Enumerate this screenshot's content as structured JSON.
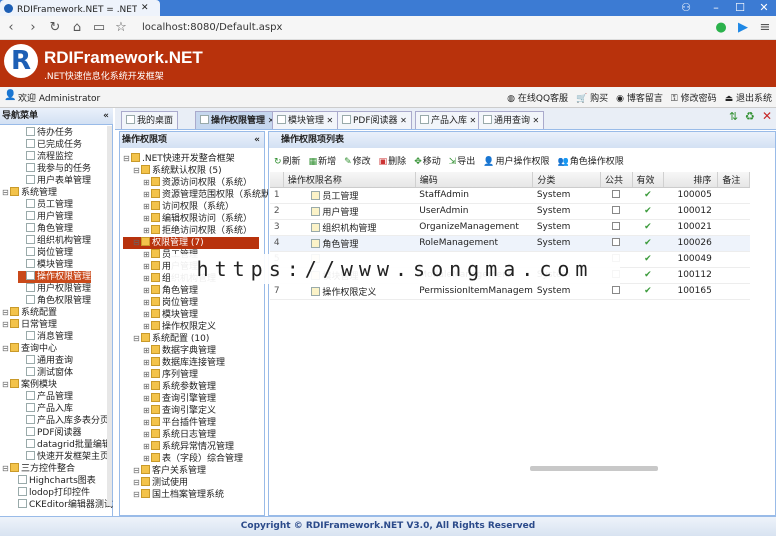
{
  "browser": {
    "tab_title": "RDIFramework.NET = .NET快",
    "address": "localhost:8080/Default.aspx"
  },
  "header": {
    "logo_letter": "R",
    "title": "RDIFramework.NET",
    "subtitle": ".NET快速信息化系统开发框架"
  },
  "userbar": {
    "welcome": "欢迎 Administrator",
    "links": [
      "在线QQ客服",
      "购买",
      "博客留言",
      "修改密码",
      "退出系统"
    ]
  },
  "sidebar": {
    "title": "导航菜单",
    "items": [
      {
        "label": "待办任务",
        "indent": 2
      },
      {
        "label": "已完成任务",
        "indent": 2
      },
      {
        "label": "流程监控",
        "indent": 2
      },
      {
        "label": "我参与的任务",
        "indent": 2
      },
      {
        "label": "用户表单管理",
        "indent": 2
      },
      {
        "label": "系统管理",
        "indent": 0,
        "folder": true
      },
      {
        "label": "员工管理",
        "indent": 2
      },
      {
        "label": "用户管理",
        "indent": 2
      },
      {
        "label": "角色管理",
        "indent": 2
      },
      {
        "label": "组织机构管理",
        "indent": 2
      },
      {
        "label": "岗位管理",
        "indent": 2
      },
      {
        "label": "模块管理",
        "indent": 2
      },
      {
        "label": "操作权限管理",
        "indent": 2,
        "selected": true
      },
      {
        "label": "用户权限管理",
        "indent": 2
      },
      {
        "label": "角色权限管理",
        "indent": 2
      },
      {
        "label": "系统配置",
        "indent": 0,
        "folder": true
      },
      {
        "label": "日常管理",
        "indent": 0,
        "folder": true
      },
      {
        "label": "消息管理",
        "indent": 2
      },
      {
        "label": "查询中心",
        "indent": 0,
        "folder": true
      },
      {
        "label": "通用查询",
        "indent": 2
      },
      {
        "label": "测试窗体",
        "indent": 2
      },
      {
        "label": "案例模块",
        "indent": 0,
        "folder": true
      },
      {
        "label": "产品管理",
        "indent": 2
      },
      {
        "label": "产品入库",
        "indent": 2
      },
      {
        "label": "产品入库多表分页",
        "indent": 2
      },
      {
        "label": "PDF阅读器",
        "indent": 2
      },
      {
        "label": "datagrid批量编辑",
        "indent": 2
      },
      {
        "label": "快速开发框架主页",
        "indent": 2
      },
      {
        "label": "三方控件整合",
        "indent": 0,
        "folder": true
      },
      {
        "label": "Highcharts图表",
        "indent": 1
      },
      {
        "label": "lodop打印控件",
        "indent": 1
      },
      {
        "label": "CKEditor编辑器测试",
        "indent": 1
      }
    ]
  },
  "tabs": [
    {
      "label": "我的桌面",
      "active": false
    },
    {
      "label": "操作权限管理",
      "active": true
    },
    {
      "label": "模块管理",
      "active": false
    },
    {
      "label": "PDF阅读器",
      "active": false
    },
    {
      "label": "产品入库",
      "active": false
    },
    {
      "label": "通用查询",
      "active": false
    }
  ],
  "tree": {
    "title": "操作权限项",
    "items": [
      {
        "label": ".NET快速开发整合框架",
        "indent": 0
      },
      {
        "label": "系统默认权限 (5)",
        "indent": 1
      },
      {
        "label": "资源访问权限（系统）",
        "indent": 2
      },
      {
        "label": "资源管理范围权限（系统默",
        "indent": 2
      },
      {
        "label": "访问权限（系统）",
        "indent": 2
      },
      {
        "label": "编辑权限访问（系统）",
        "indent": 2
      },
      {
        "label": "拒绝访问权限（系统）",
        "indent": 2
      },
      {
        "label": "权限管理 (7)",
        "indent": 1,
        "selected": true
      },
      {
        "label": "员工管理",
        "indent": 2
      },
      {
        "label": "用户管理",
        "indent": 2
      },
      {
        "label": "组织机构管理",
        "indent": 2
      },
      {
        "label": "角色管理",
        "indent": 2
      },
      {
        "label": "岗位管理",
        "indent": 2
      },
      {
        "label": "模块管理",
        "indent": 2
      },
      {
        "label": "操作权限定义",
        "indent": 2
      },
      {
        "label": "系统配置 (10)",
        "indent": 1
      },
      {
        "label": "数据字典管理",
        "indent": 2
      },
      {
        "label": "数据库连接管理",
        "indent": 2
      },
      {
        "label": "序列管理",
        "indent": 2
      },
      {
        "label": "系统参数管理",
        "indent": 2
      },
      {
        "label": "查询引擎管理",
        "indent": 2
      },
      {
        "label": "查询引擎定义",
        "indent": 2
      },
      {
        "label": "平台插件管理",
        "indent": 2
      },
      {
        "label": "系统日志管理",
        "indent": 2
      },
      {
        "label": "系统异常情况管理",
        "indent": 2
      },
      {
        "label": "表（字段）综合管理",
        "indent": 2
      },
      {
        "label": "客户关系管理",
        "indent": 1
      },
      {
        "label": "测试使用",
        "indent": 1
      },
      {
        "label": "国土档案管理系统",
        "indent": 1
      }
    ]
  },
  "grid": {
    "title": "操作权限项列表",
    "toolbar": [
      "刷新",
      "新增",
      "修改",
      "删除",
      "移动",
      "导出",
      "用户操作权限",
      "角色操作权限"
    ],
    "columns": [
      "操作权限名称",
      "编码",
      "分类",
      "公共",
      "有效",
      "排序",
      "备注"
    ],
    "rows": [
      {
        "n": "1",
        "name": "员工管理",
        "code": "StaffAdmin",
        "cat": "System",
        "sort": "100005"
      },
      {
        "n": "2",
        "name": "用户管理",
        "code": "UserAdmin",
        "cat": "System",
        "sort": "100012"
      },
      {
        "n": "3",
        "name": "组织机构管理",
        "code": "OrganizeManagement",
        "cat": "System",
        "sort": "100021"
      },
      {
        "n": "4",
        "name": "角色管理",
        "code": "RoleManagement",
        "cat": "System",
        "sort": "100026"
      },
      {
        "n": "5",
        "name": "",
        "code": "",
        "cat": "",
        "sort": "100049"
      },
      {
        "n": "6",
        "name": "模块管理",
        "code": "ModuleManagement",
        "cat": "System",
        "sort": "100112"
      },
      {
        "n": "7",
        "name": "操作权限定义",
        "code": "PermissionItemManagem",
        "cat": "System",
        "sort": "100165"
      }
    ]
  },
  "watermark": "https://www.songma.com",
  "footer": "Copyright © RDIFramework.NET V3.0, All Rights Reserved",
  "colors": {
    "brand": "#b8320c",
    "panel_border": "#99bbe8",
    "selected": "#c9491a"
  }
}
